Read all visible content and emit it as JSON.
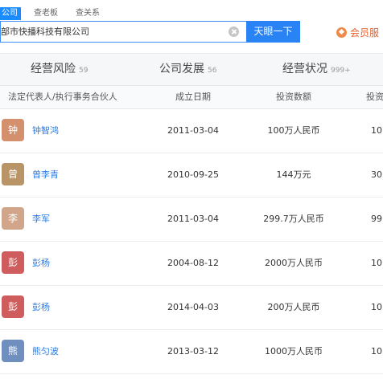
{
  "search": {
    "type_tabs": [
      "公司",
      "查老板",
      "查关系"
    ],
    "query": "部市快播科技有限公司",
    "button_label": "天眼一下",
    "vip_label": "会员服"
  },
  "section_tabs": [
    {
      "label": "经营风险",
      "count": "59"
    },
    {
      "label": "公司发展",
      "count": "56"
    },
    {
      "label": "经营状况",
      "count": "999+"
    }
  ],
  "table": {
    "columns": [
      "法定代表人/执行事务合伙人",
      "成立日期",
      "投资数额",
      "投资"
    ],
    "rows": [
      {
        "avatar_char": "钟",
        "avatar_color": "#d48f6d",
        "name": "钟智鸿",
        "date": "2011-03-04",
        "amount": "100万人民币",
        "last": "10"
      },
      {
        "avatar_char": "曾",
        "avatar_color": "#b89466",
        "name": "曾李青",
        "date": "2010-09-25",
        "amount": "144万元",
        "last": "30"
      },
      {
        "avatar_char": "李",
        "avatar_color": "#d0a58a",
        "name": "李军",
        "date": "2011-03-04",
        "amount": "299.7万人民币",
        "last": "99"
      },
      {
        "avatar_char": "彭",
        "avatar_color": "#d05d5d",
        "name": "彭杨",
        "date": "2004-08-12",
        "amount": "2000万人民币",
        "last": "10"
      },
      {
        "avatar_char": "彭",
        "avatar_color": "#d05d5d",
        "name": "彭杨",
        "date": "2014-04-03",
        "amount": "200万人民币",
        "last": "10"
      },
      {
        "avatar_char": "熊",
        "avatar_color": "#6f8fbf",
        "name": "熊匀波",
        "date": "2013-03-12",
        "amount": "1000万人民币",
        "last": "10"
      }
    ]
  }
}
